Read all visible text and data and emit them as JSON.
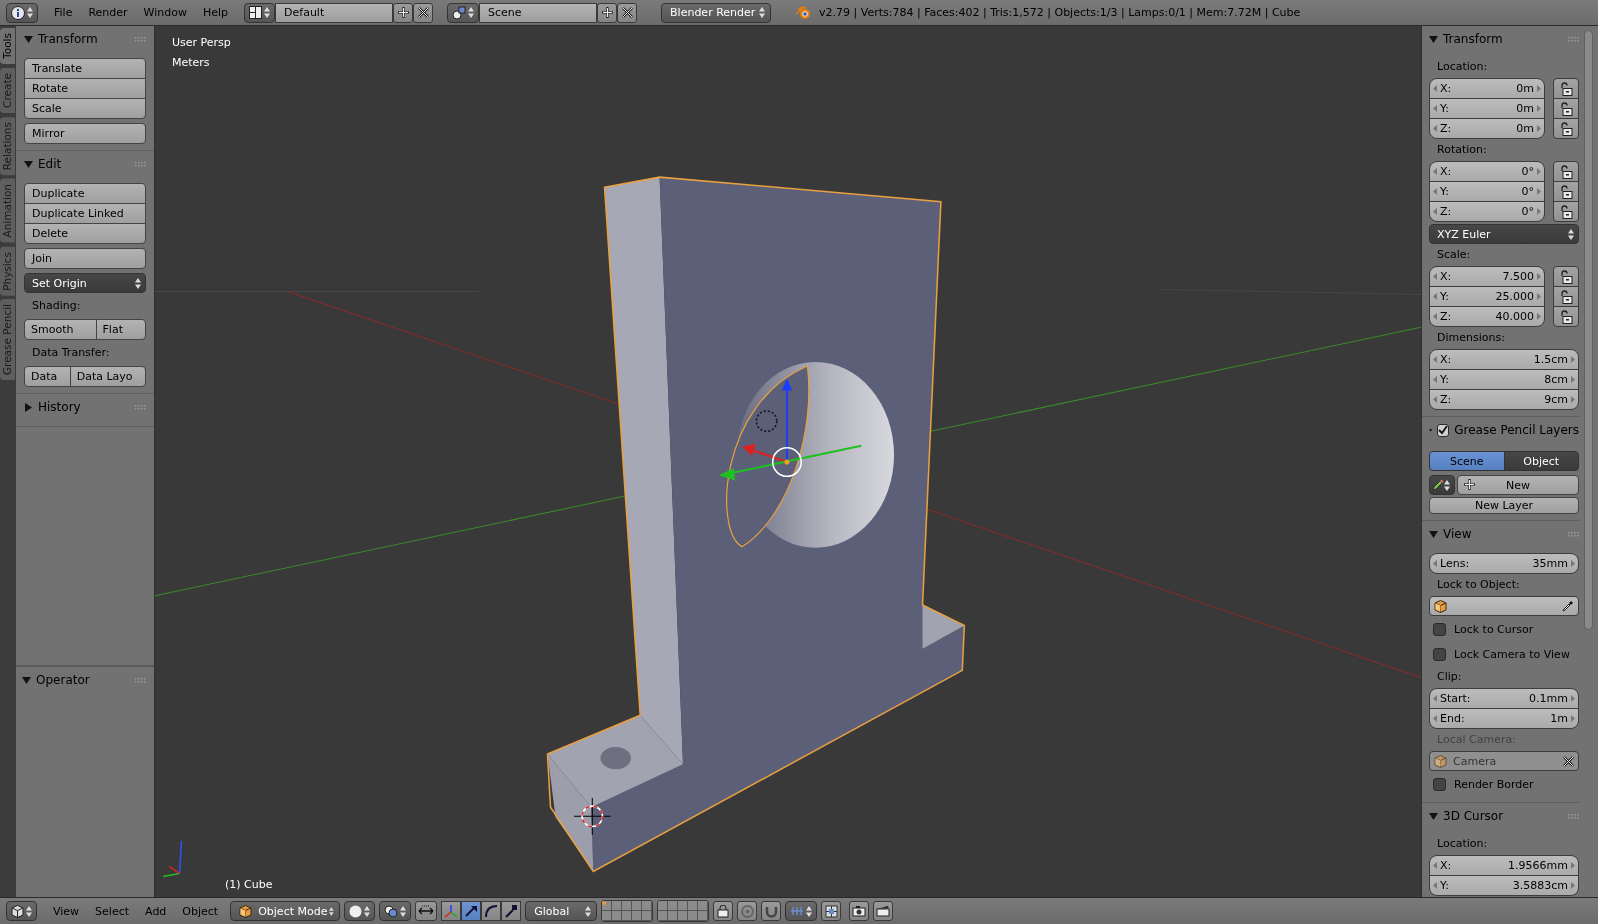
{
  "top_bar": {
    "menus": [
      "File",
      "Render",
      "Window",
      "Help"
    ],
    "screen_layout": "Default",
    "scene": "Scene",
    "render_engine": "Blender Render",
    "stats": "v2.79 | Verts:784 | Faces:402 | Tris:1,572 | Objects:1/3 | Lamps:0/1 | Mem:7.72M | Cube"
  },
  "tool_tabs": [
    {
      "label": "Tools",
      "selected": true
    },
    {
      "label": "Create",
      "selected": false
    },
    {
      "label": "Relations",
      "selected": false
    },
    {
      "label": "Animation",
      "selected": false
    },
    {
      "label": "Physics",
      "selected": false
    },
    {
      "label": "Grease Pencil",
      "selected": false
    }
  ],
  "tool_shelf": {
    "panels": [
      {
        "title": "Transform",
        "expanded": true,
        "items": [
          {
            "kind": "column",
            "buttons": [
              "Translate",
              "Rotate",
              "Scale"
            ]
          },
          {
            "kind": "column",
            "buttons": [
              "Mirror"
            ]
          }
        ]
      },
      {
        "title": "Edit",
        "expanded": true,
        "items": [
          {
            "kind": "column",
            "buttons": [
              "Duplicate",
              "Duplicate Linked",
              "Delete"
            ]
          },
          {
            "kind": "column",
            "buttons": [
              "Join"
            ]
          },
          {
            "kind": "menu",
            "value": "Set Origin"
          },
          {
            "kind": "label",
            "text": "Shading:"
          },
          {
            "kind": "row",
            "buttons": [
              "Smooth",
              "Flat"
            ]
          },
          {
            "kind": "label",
            "text": "Data Transfer:"
          },
          {
            "kind": "row",
            "buttons": [
              "Data",
              "Data Layo"
            ]
          }
        ]
      },
      {
        "title": "History",
        "expanded": false
      }
    ]
  },
  "operator_panel": {
    "title": "Operator",
    "expanded": true
  },
  "viewport": {
    "view_name": "User Persp",
    "units": "Meters",
    "object_label": "(1) Cube"
  },
  "properties": {
    "panels": [
      {
        "title": "Transform",
        "expanded": true,
        "items": [
          {
            "kind": "label",
            "text": "Location:"
          },
          {
            "kind": "vector",
            "locks": true,
            "fields": [
              {
                "label": "X:",
                "value": "0m"
              },
              {
                "label": "Y:",
                "value": "0m"
              },
              {
                "label": "Z:",
                "value": "0m"
              }
            ]
          },
          {
            "kind": "label",
            "text": "Rotation:"
          },
          {
            "kind": "vector",
            "locks": true,
            "fields": [
              {
                "label": "X:",
                "value": "0°"
              },
              {
                "label": "Y:",
                "value": "0°"
              },
              {
                "label": "Z:",
                "value": "0°"
              }
            ]
          },
          {
            "kind": "menu",
            "value": "XYZ Euler"
          },
          {
            "kind": "label",
            "text": "Scale:"
          },
          {
            "kind": "vector",
            "locks": true,
            "fields": [
              {
                "label": "X:",
                "value": "7.500"
              },
              {
                "label": "Y:",
                "value": "25.000"
              },
              {
                "label": "Z:",
                "value": "40.000"
              }
            ]
          },
          {
            "kind": "label",
            "text": "Dimensions:"
          },
          {
            "kind": "vector",
            "locks": false,
            "fields": [
              {
                "label": "X:",
                "value": "1.5cm"
              },
              {
                "label": "Y:",
                "value": "8cm"
              },
              {
                "label": "Z:",
                "value": "9cm"
              }
            ]
          }
        ]
      },
      {
        "title": "Grease Pencil Layers",
        "enabled": true,
        "expanded": true,
        "items": [
          {
            "kind": "tabs",
            "options": [
              {
                "label": "Scene",
                "selected": true
              },
              {
                "label": "Object",
                "selected": false
              }
            ]
          },
          {
            "kind": "new",
            "label": "New"
          },
          {
            "kind": "button",
            "label": "New Layer"
          }
        ]
      },
      {
        "title": "View",
        "expanded": true,
        "items": [
          {
            "kind": "vector",
            "locks": false,
            "fields": [
              {
                "label": "Lens:",
                "value": "35mm"
              }
            ]
          },
          {
            "kind": "label",
            "text": "Lock to Object:"
          },
          {
            "kind": "object",
            "disabled": false
          },
          {
            "kind": "checkbox",
            "label": "Lock to Cursor",
            "checked": false
          },
          {
            "kind": "checkbox",
            "label": "Lock Camera to View",
            "checked": false
          },
          {
            "kind": "label",
            "text": "Clip:"
          },
          {
            "kind": "vector",
            "locks": false,
            "fields": [
              {
                "label": "Start:",
                "value": "0.1mm"
              },
              {
                "label": "End:",
                "value": "1m"
              }
            ]
          },
          {
            "kind": "label",
            "text": "Local Camera:",
            "disabled": true
          },
          {
            "kind": "object",
            "value": "Camera",
            "disabled": true
          },
          {
            "kind": "checkbox",
            "label": "Render Border",
            "checked": false
          }
        ]
      },
      {
        "title": "3D Cursor",
        "expanded": true,
        "items": [
          {
            "kind": "label",
            "text": "Location:"
          },
          {
            "kind": "vector",
            "locks": false,
            "fields": [
              {
                "label": "X:",
                "value": "1.9566mm"
              },
              {
                "label": "Y:",
                "value": "3.5883cm"
              }
            ]
          }
        ]
      }
    ]
  },
  "bottom_bar": {
    "menus": [
      "View",
      "Select",
      "Add",
      "Object"
    ],
    "mode": "Object Mode",
    "orientation": "Global",
    "manipulators": [
      {
        "selected": false
      },
      {
        "selected": true
      },
      {
        "selected": false
      },
      {
        "selected": false
      }
    ],
    "layers": [
      {
        "occupied": true
      },
      {
        "occupied": false
      },
      {
        "occupied": false
      },
      {
        "occupied": false
      },
      {
        "occupied": false
      },
      {
        "occupied": false
      },
      {
        "occupied": false
      },
      {
        "occupied": false
      },
      {
        "occupied": false
      },
      {
        "occupied": false
      },
      {
        "occupied": false
      },
      {
        "occupied": false
      },
      {
        "occupied": false
      },
      {
        "occupied": false
      },
      {
        "occupied": false
      },
      {
        "occupied": false
      },
      {
        "occupied": false
      },
      {
        "occupied": false
      },
      {
        "occupied": false
      },
      {
        "occupied": false
      }
    ]
  }
}
